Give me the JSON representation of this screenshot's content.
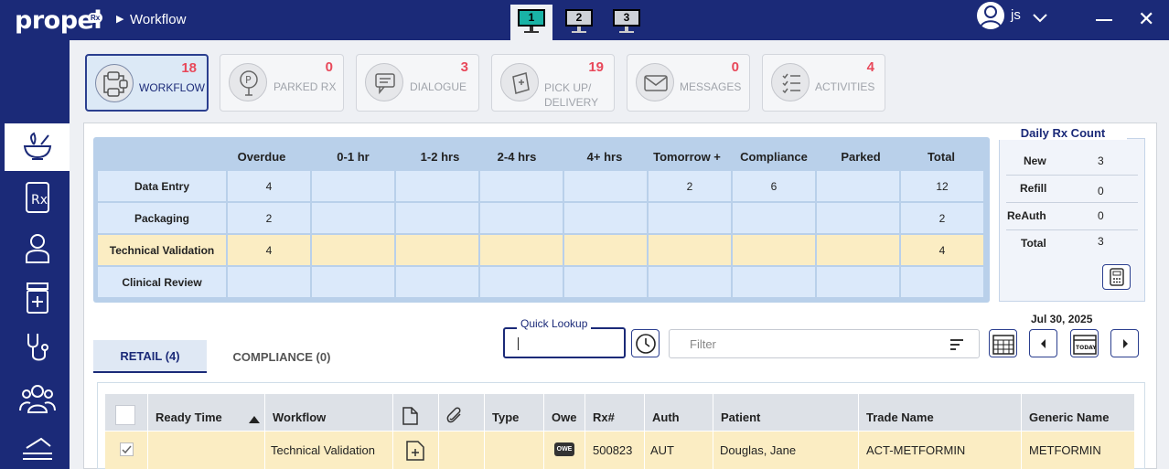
{
  "app": {
    "logo": "propel",
    "logo_badge": "Rx",
    "breadcrumb": "Workflow",
    "user": "js"
  },
  "screens": [
    "1",
    "2",
    "3"
  ],
  "cards": [
    {
      "label": "WORKFLOW",
      "count": "18",
      "icon": "workflow-icon"
    },
    {
      "label": "PARKED RX",
      "count": "0",
      "icon": "parked-rx-icon"
    },
    {
      "label": "DIALOGUE",
      "count": "3",
      "icon": "dialogue-icon"
    },
    {
      "label": "PICK UP/\nDELIVERY",
      "line1": "PICK UP/",
      "line2": "DELIVERY",
      "count": "19",
      "icon": "pickup-delivery-icon"
    },
    {
      "label": "MESSAGES",
      "count": "0",
      "icon": "messages-icon"
    },
    {
      "label": "ACTIVITIES",
      "count": "4",
      "icon": "activities-icon"
    }
  ],
  "nav_icons": [
    "rx-mortar-icon",
    "prescription-icon",
    "patient-icon",
    "medicine-bottle-icon",
    "stethoscope-icon",
    "group-icon",
    "conveyor-icon"
  ],
  "grid": {
    "columns": [
      "Overdue",
      "0-1 hr",
      "1-2 hrs",
      "2-4 hrs",
      "4+ hrs",
      "Tomorrow +",
      "Compliance",
      "Parked",
      "Total"
    ],
    "rows": [
      {
        "label": "Data Entry",
        "cells": [
          "4",
          "",
          "",
          "",
          "",
          "2",
          "6",
          "",
          "12"
        ]
      },
      {
        "label": "Packaging",
        "cells": [
          "2",
          "",
          "",
          "",
          "",
          "",
          "",
          "",
          "2"
        ]
      },
      {
        "label": "Technical Validation",
        "cells": [
          "4",
          "",
          "",
          "",
          "",
          "",
          "",
          "",
          "4"
        ]
      },
      {
        "label": "Clinical Review",
        "cells": [
          "",
          "",
          "",
          "",
          "",
          "",
          "",
          "",
          ""
        ]
      }
    ]
  },
  "daily": {
    "title": "Daily Rx Count",
    "rows": [
      {
        "label": "New",
        "value": "3"
      },
      {
        "label": "Refill",
        "value": "0"
      },
      {
        "label": "ReAuth",
        "value": "0"
      },
      {
        "label": "Total",
        "value": "3"
      }
    ]
  },
  "tabs": {
    "retail": "RETAIL (4)",
    "compliance": "COMPLIANCE (0)"
  },
  "quick_lookup": {
    "label": "Quick Lookup",
    "value": ""
  },
  "filter": {
    "placeholder": "Filter"
  },
  "date": "Jul 30, 2025",
  "table": {
    "headers": [
      "Ready Time",
      "Workflow",
      "Type",
      "Owe",
      "Rx#",
      "Auth",
      "Patient",
      "Trade Name",
      "Generic Name"
    ],
    "rows": [
      {
        "checked": true,
        "ready_time": "",
        "workflow": "Technical Validation",
        "type": "",
        "owe": "OWE",
        "rx": "500823",
        "auth": "AUT",
        "patient": "Douglas, Jane",
        "trade_name": "ACT-METFORMIN",
        "generic_name": "METFORMIN"
      }
    ]
  },
  "colors": {
    "navy": "#1b2a78",
    "accent_red": "#e8485a",
    "teal": "#19b3a6",
    "row_highlight": "#fbedc3",
    "grid_cell": "#dbe9fa"
  }
}
